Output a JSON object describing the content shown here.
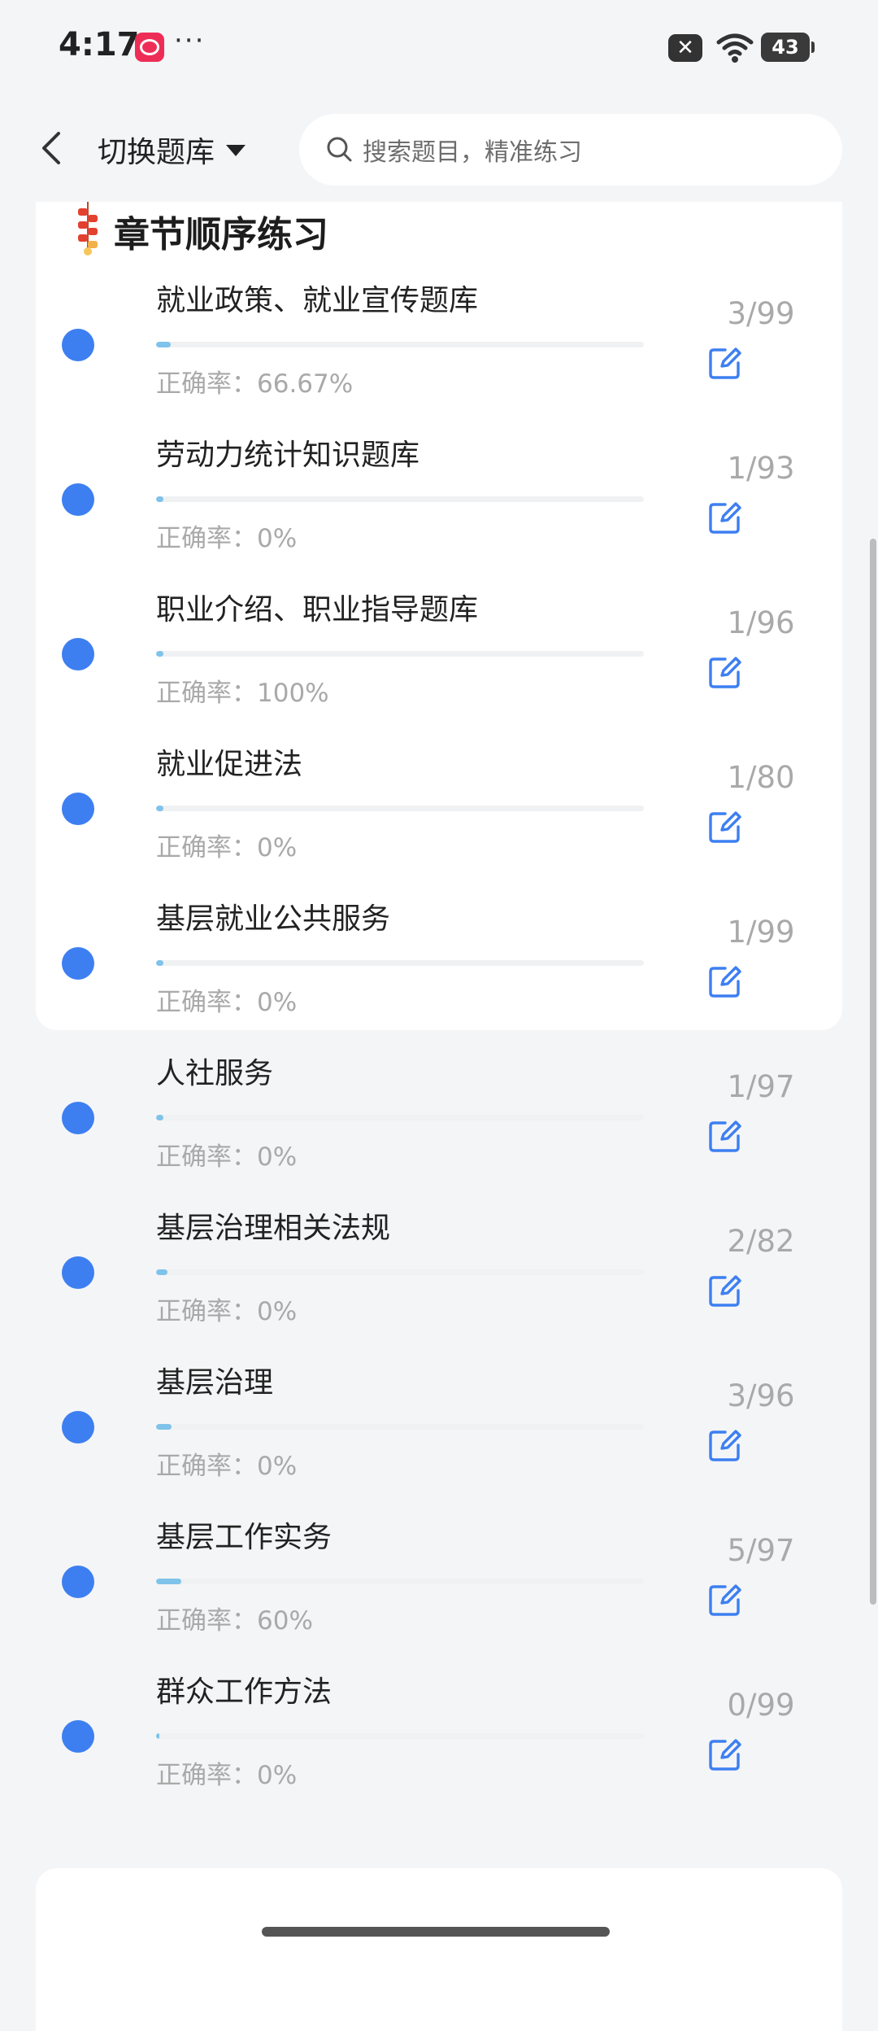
{
  "status": {
    "time": "4:17",
    "dots": "···",
    "battery": "43"
  },
  "header": {
    "switch_label": "切换题库",
    "search_placeholder": "搜索题目，精准练习"
  },
  "section": {
    "title": "章节顺序练习"
  },
  "items": [
    {
      "title": "就业政策、就业宣传题库",
      "accuracy": "正确率：66.67%",
      "progress": "3/99",
      "fraction": 0.03
    },
    {
      "title": "劳动力统计知识题库",
      "accuracy": "正确率：0%",
      "progress": "1/93",
      "fraction": 0.011
    },
    {
      "title": "职业介绍、职业指导题库",
      "accuracy": "正确率：100%",
      "progress": "1/96",
      "fraction": 0.01
    },
    {
      "title": "就业促进法",
      "accuracy": "正确率：0%",
      "progress": "1/80",
      "fraction": 0.0125
    },
    {
      "title": "基层就业公共服务",
      "accuracy": "正确率：0%",
      "progress": "1/99",
      "fraction": 0.01
    },
    {
      "title": "人社服务",
      "accuracy": "正确率：0%",
      "progress": "1/97",
      "fraction": 0.0103
    },
    {
      "title": "基层治理相关法规",
      "accuracy": "正确率：0%",
      "progress": "2/82",
      "fraction": 0.024
    },
    {
      "title": "基层治理",
      "accuracy": "正确率：0%",
      "progress": "3/96",
      "fraction": 0.031
    },
    {
      "title": "基层工作实务",
      "accuracy": "正确率：60%",
      "progress": "5/97",
      "fraction": 0.052
    },
    {
      "title": "群众工作方法",
      "accuracy": "正确率：0%",
      "progress": "0/99",
      "fraction": 0.0
    }
  ],
  "colors": {
    "accent": "#3d7ff1",
    "bar": "#7fc3ea",
    "muted": "#a9a9a9"
  }
}
